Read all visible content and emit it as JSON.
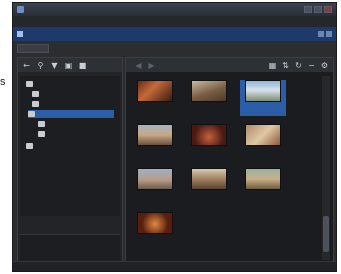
{
  "side_letter": "s",
  "window": {
    "title": ""
  },
  "menu": {
    "items": [
      "",
      "",
      "",
      "",
      "",
      "",
      ""
    ]
  },
  "document": {
    "title": ""
  },
  "breadcrumb": "",
  "left_toolbar": [
    {
      "icon": "back-arrow-icon"
    },
    {
      "icon": "search-icon"
    },
    {
      "icon": "filter-icon"
    },
    {
      "icon": "trash-icon"
    },
    {
      "icon": "lock-icon"
    }
  ],
  "tree": [
    {
      "icon": "folder-icon",
      "label": ""
    },
    {
      "icon": "folder-icon",
      "label": ""
    },
    {
      "icon": "folder-icon",
      "label": ""
    },
    {
      "icon": "folder-icon",
      "label": ""
    },
    {
      "icon": "folder-icon",
      "label": ""
    },
    {
      "icon": "folder-icon",
      "label": ""
    },
    {
      "icon": "folder-icon",
      "label": ""
    }
  ],
  "stats": [
    {
      "label": "",
      "value": ""
    },
    {
      "label": "",
      "value": ""
    },
    {
      "label": "",
      "value": ""
    }
  ],
  "right_toolbar": [
    {
      "icon": "grid-view-icon"
    },
    {
      "icon": "sort-icon"
    },
    {
      "icon": "rotate-icon"
    },
    {
      "icon": "zoom-icon"
    },
    {
      "icon": "settings-icon"
    }
  ],
  "thumbnails": [
    {
      "caption1": "",
      "caption2": ""
    },
    {
      "caption1": "",
      "caption2": ""
    },
    {
      "caption1": "",
      "caption2": ""
    },
    {
      "caption1": "",
      "caption2": ""
    },
    {
      "caption1": "",
      "caption2": ""
    },
    {
      "caption1": "",
      "caption2": ""
    },
    {
      "caption1": "",
      "caption2": ""
    },
    {
      "caption1": "",
      "caption2": ""
    },
    {
      "caption1": "",
      "caption2": ""
    },
    {
      "caption1": "",
      "caption2": ""
    }
  ],
  "status": {
    "segments": [
      "",
      "",
      "",
      ""
    ]
  },
  "colors": {
    "window_bg": "#2b2d31",
    "selection": "#2c5ea8",
    "document_bar": "#1d3a6a",
    "pane_bg": "#1a1c1f"
  }
}
